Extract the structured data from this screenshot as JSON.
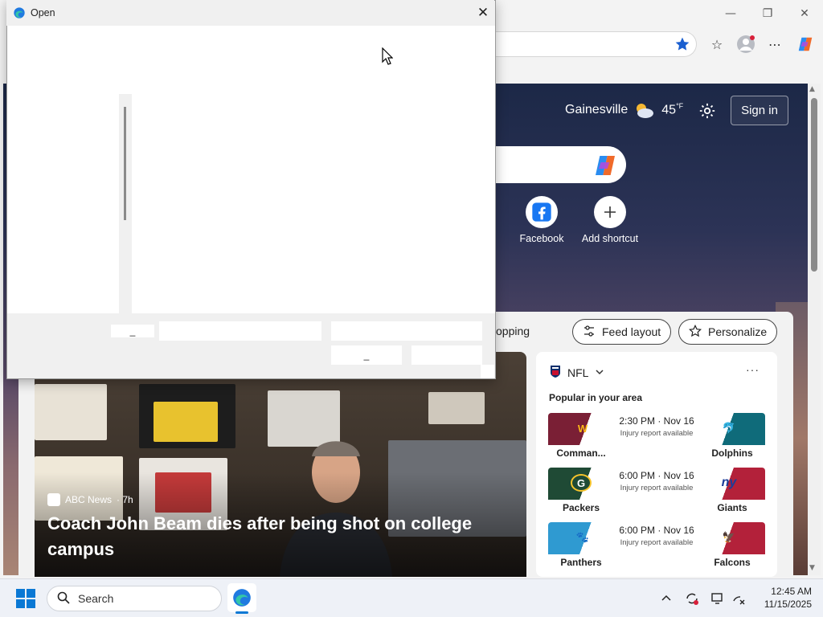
{
  "browser": {
    "window_controls": {
      "minimize": "—",
      "restore": "❐",
      "close": "✕"
    },
    "toolbar": {
      "favorites": "☆",
      "more": "⋯"
    }
  },
  "page": {
    "weather": {
      "city": "Gainesville",
      "temperature": "45",
      "unit": "°F"
    },
    "signin_label": "Sign in",
    "shortcuts": [
      {
        "label": "Facebook",
        "icon": "facebook-icon"
      },
      {
        "label": "Add shortcut",
        "icon": "plus-icon"
      }
    ],
    "feed": {
      "tab_partial": "opping",
      "feed_layout_label": "Feed layout",
      "personalize_label": "Personalize",
      "hero": {
        "source": "ABC News",
        "age": "· 7h",
        "headline": "Coach John Beam dies after being shot on college campus"
      },
      "nfl": {
        "title": "NFL",
        "more": "···",
        "subtitle": "Popular in your area",
        "games": [
          {
            "home": "Comman...",
            "away": "Dolphins",
            "time": "2:30 PM · Nov 16",
            "note": "Injury report available",
            "home_color": "#7a1f35",
            "away_color": "#0f6b7a",
            "home_logo": "W",
            "away_logo": "🐬"
          },
          {
            "home": "Packers",
            "away": "Giants",
            "time": "6:00 PM · Nov 16",
            "note": "Injury report available",
            "home_color": "#1f4a35",
            "away_color": "#b3213a",
            "home_logo": "G",
            "away_logo": "ny"
          },
          {
            "home": "Panthers",
            "away": "Falcons",
            "time": "6:00 PM · Nov 16",
            "note": "Injury report available",
            "home_color": "#2f9ad1",
            "away_color": "#b3213a",
            "home_logo": "🐾",
            "away_logo": "🦅"
          }
        ]
      }
    }
  },
  "dialog": {
    "title": "Open",
    "close": "✕",
    "filename_button": "_",
    "open_button": "_"
  },
  "taskbar": {
    "search_label": "Search",
    "time": "12:45 AM",
    "date": "11/15/2025"
  },
  "colors": {
    "accent": "#0a78d4",
    "favorite_star": "#1a5fd0"
  }
}
